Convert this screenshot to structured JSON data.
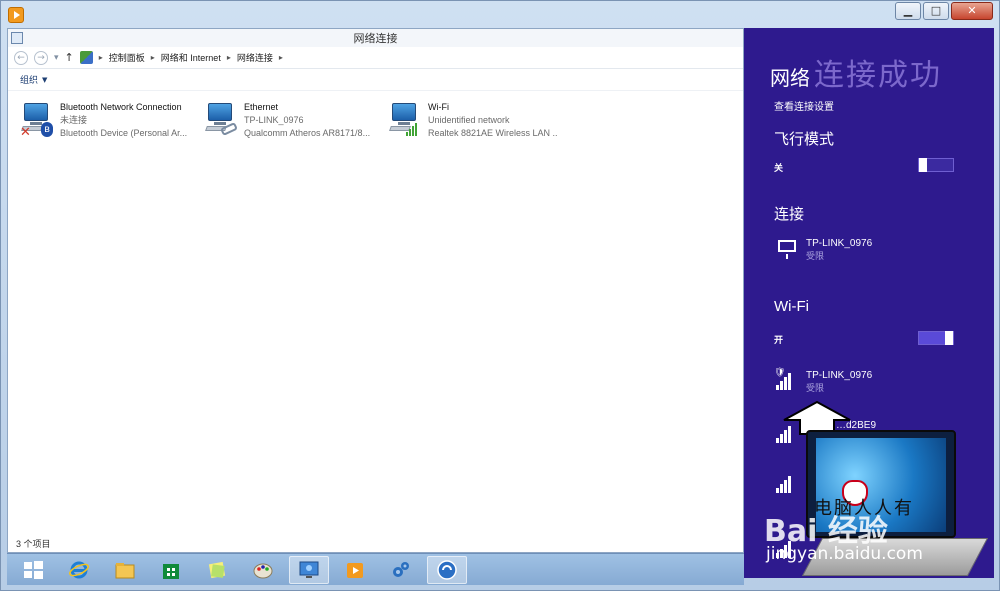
{
  "window": {
    "minimize_symbol": "▁",
    "maximize_symbol": "□",
    "close_symbol": "✕"
  },
  "explorer": {
    "title": "网络连接",
    "breadcrumb": [
      "控制面板",
      "网络和 Internet",
      "网络连接"
    ],
    "toolbar": {
      "organize": "组织"
    },
    "status": "3 个项目",
    "connections": [
      {
        "name": "Bluetooth Network Connection",
        "status": "未连接",
        "device": "Bluetooth Device (Personal Ar...",
        "icon": "bluetooth-adapter-icon"
      },
      {
        "name": "Ethernet",
        "status": "TP-LINK_0976",
        "device": "Qualcomm Atheros AR8171/8...",
        "icon": "ethernet-adapter-icon"
      },
      {
        "name": "Wi-Fi",
        "status": "Unidentified network",
        "device": "Realtek 8821AE Wireless LAN ...",
        "icon": "wifi-adapter-icon"
      }
    ]
  },
  "flyout": {
    "title": "网络",
    "overlay_text": "连接成功",
    "view_settings": "查看连接设置",
    "airplane_mode": {
      "label": "飞行模式",
      "state": "关",
      "on": false
    },
    "connections_header": "连接",
    "wired": {
      "name": "TP-LINK_0976",
      "status": "受限"
    },
    "wifi": {
      "label": "Wi-Fi",
      "state": "开",
      "on": true
    },
    "wifi_networks": [
      {
        "name": "TP-LINK_0976",
        "status": "受限",
        "secured": true
      },
      {
        "name": "…d2BE9",
        "status": "",
        "secured": false
      }
    ]
  },
  "watermark": {
    "title": "电脑人人有",
    "brand": "Bai 经验",
    "url": "jingyan.baidu.com"
  },
  "taskbar": {
    "items": [
      {
        "name": "start",
        "icon": "windows-logo-icon",
        "active": false
      },
      {
        "name": "ie",
        "icon": "internet-explorer-icon",
        "active": false
      },
      {
        "name": "explorer",
        "icon": "file-explorer-icon",
        "active": false
      },
      {
        "name": "store",
        "icon": "store-icon",
        "active": false
      },
      {
        "name": "stickies",
        "icon": "sticky-notes-icon",
        "active": false
      },
      {
        "name": "paint",
        "icon": "paint-icon",
        "active": false
      },
      {
        "name": "network-connections",
        "icon": "network-window-icon",
        "active": true
      },
      {
        "name": "media",
        "icon": "media-player-icon",
        "active": false
      },
      {
        "name": "settings",
        "icon": "gears-icon",
        "active": false
      },
      {
        "name": "recorder",
        "icon": "screen-recorder-icon",
        "active": true
      }
    ]
  }
}
